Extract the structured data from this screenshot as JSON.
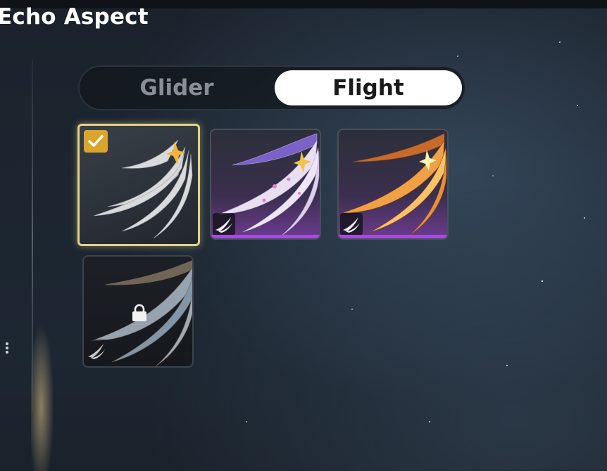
{
  "header": {
    "title": "Echo Aspect"
  },
  "toggle": {
    "tabs": [
      {
        "label": "Glider",
        "selected": false
      },
      {
        "label": "Flight",
        "selected": true
      }
    ]
  },
  "aspects": [
    {
      "id": 1,
      "name_icon": "white-wing-art",
      "selected": true,
      "locked": false
    },
    {
      "id": 2,
      "name_icon": "lilac-wing-art",
      "rarity": "purple",
      "selected": false,
      "locked": false
    },
    {
      "id": 3,
      "name_icon": "amber-wing-art",
      "rarity": "purple",
      "selected": false,
      "locked": false
    },
    {
      "id": 4,
      "name_icon": "pale-blue-wing-art",
      "selected": false,
      "locked": true
    }
  ],
  "colors": {
    "selected_border": "#e2d28a",
    "check_badge": "#d9a62b",
    "rarity_purple": "#a64be0",
    "active_tab_bg": "#ffffff"
  }
}
